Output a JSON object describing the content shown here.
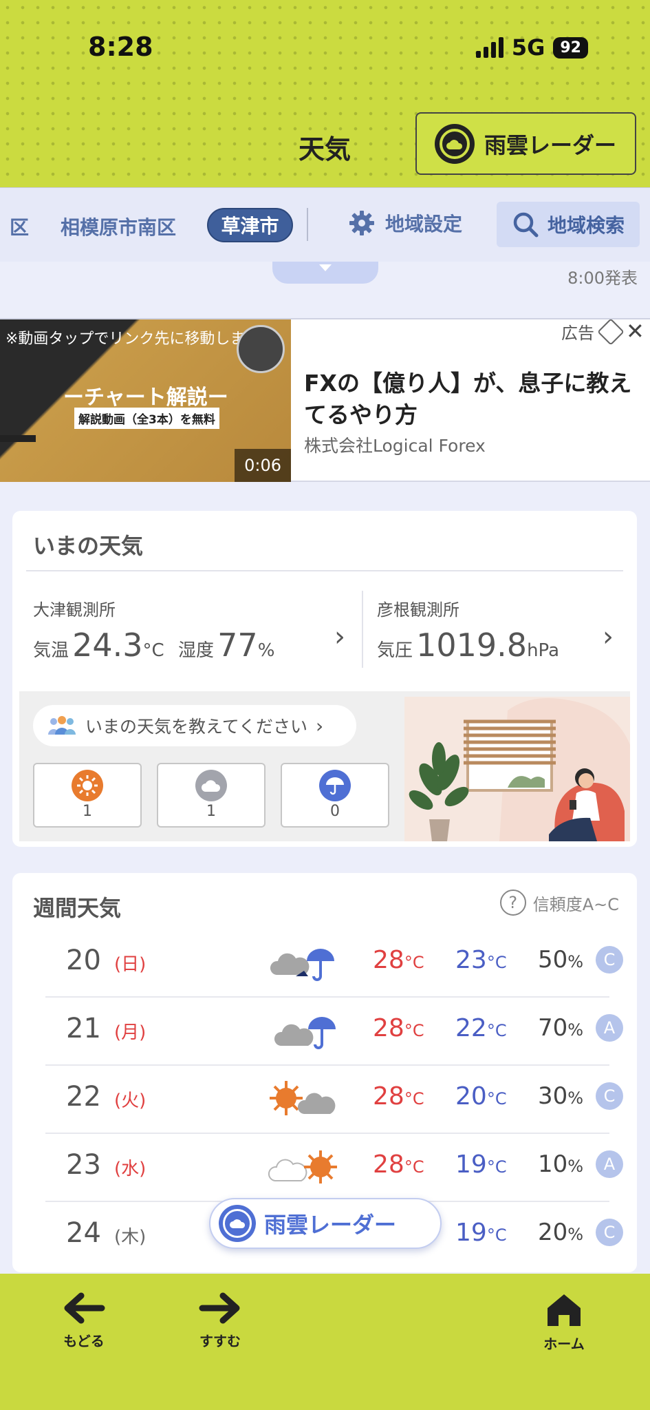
{
  "status": {
    "time": "8:28",
    "network": "5G",
    "battery": "92"
  },
  "header": {
    "title": "天気",
    "radar_button": "雨雲レーダー"
  },
  "regions": {
    "edge": "区",
    "items": [
      "相模原市南区"
    ],
    "active": "草津市",
    "setting": "地域設定",
    "search": "地域検索"
  },
  "strip": {
    "announced": "8:00発表"
  },
  "ad": {
    "video_note": "※動画タップでリンク先に移動します",
    "video_title": "ーチャート解説ー",
    "video_sub": "解説動画（全3本）を無料",
    "duration": "0:06",
    "label": "広告",
    "title": "FXの【億り人】が、息子に教えてるやり方",
    "sponsor": "株式会社Logical Forex"
  },
  "now": {
    "title": "いまの天気",
    "station1": {
      "name": "大津観測所",
      "temp_label": "気温",
      "temp": "24.3",
      "temp_unit": "°C",
      "hum_label": "湿度",
      "hum": "77",
      "hum_unit": "%"
    },
    "station2": {
      "name": "彦根観測所",
      "pres_label": "気圧",
      "pres": "1019.8",
      "pres_unit": "hPa"
    },
    "report_prompt": "いまの天気を教えてください",
    "votes": {
      "sunny": "1",
      "cloudy": "1",
      "rainy": "0"
    }
  },
  "weekly": {
    "title": "週間天気",
    "reliability": "信頼度A~C",
    "days": [
      {
        "date": "20",
        "weekday": "(日)",
        "hi": "28",
        "lo": "23",
        "precip": "50",
        "rel": "C",
        "icon": "cloud-rain-icon"
      },
      {
        "date": "21",
        "weekday": "(月)",
        "hi": "28",
        "lo": "22",
        "precip": "70",
        "rel": "A",
        "icon": "cloud-rain-icon"
      },
      {
        "date": "22",
        "weekday": "(火)",
        "hi": "28",
        "lo": "20",
        "precip": "30",
        "rel": "C",
        "icon": "sun-cloud-icon"
      },
      {
        "date": "23",
        "weekday": "(水)",
        "hi": "28",
        "lo": "19",
        "precip": "10",
        "rel": "A",
        "icon": "cloud-sun-icon"
      },
      {
        "date": "24",
        "weekday": "(木)",
        "hi": "",
        "lo": "19",
        "precip": "20",
        "rel": "C",
        "icon": "sun-icon"
      }
    ],
    "unit_temp": "°C",
    "unit_pct": "%"
  },
  "float_radar": "雨雲レーダー",
  "nav": {
    "back": "もどる",
    "forward": "すすむ",
    "home": "ホーム"
  },
  "colors": {
    "header_bg": "#cbdb40",
    "accent_blue": "#4f6fd4",
    "hot": "#e04040",
    "cold": "#4a5ec4"
  }
}
